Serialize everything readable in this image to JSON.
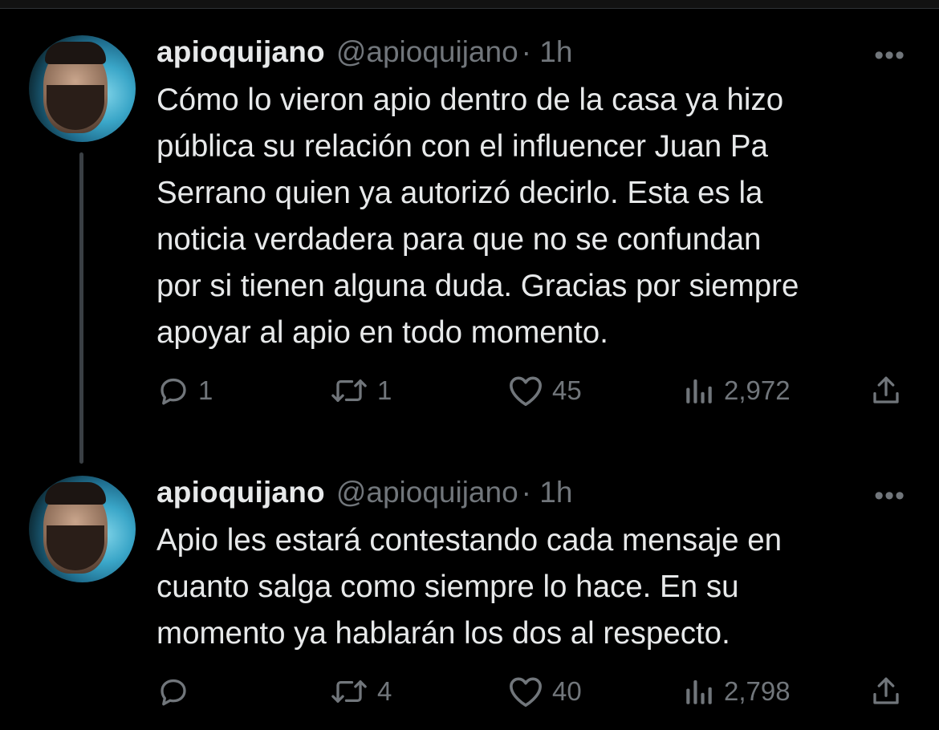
{
  "tweets": [
    {
      "author_name": "apioquijano",
      "handle": "@apioquijano",
      "time": "· 1h",
      "more": "•••",
      "lines": [
        "Cómo lo vieron apio dentro de la casa ya hizo",
        "pública su relación con el influencer Juan Pa",
        "Serrano quien ya autorizó decirlo. Esta es la",
        "noticia verdadera para que no se confundan",
        "por si tienen alguna duda. Gracias por siempre",
        "apoyar al apio en todo momento."
      ],
      "replies": "1",
      "retweets": "1",
      "likes": "45",
      "views": "2,972"
    },
    {
      "author_name": "apioquijano",
      "handle": "@apioquijano",
      "time": "· 1h",
      "more": "•••",
      "lines": [
        "Apio les estará contestando cada mensaje en",
        "cuanto salga como siempre lo hace. En su",
        "momento ya hablarán los dos al respecto."
      ],
      "replies": "",
      "retweets": "4",
      "likes": "40",
      "views": "2,798"
    }
  ],
  "icons": {
    "reply": "reply-icon",
    "retweet": "retweet-icon",
    "like": "heart-icon",
    "views": "views-icon",
    "share": "share-icon"
  },
  "colors": {
    "background": "#000000",
    "text": "#e7e9ea",
    "muted": "#71767b",
    "thread_line": "#3a3f44"
  }
}
